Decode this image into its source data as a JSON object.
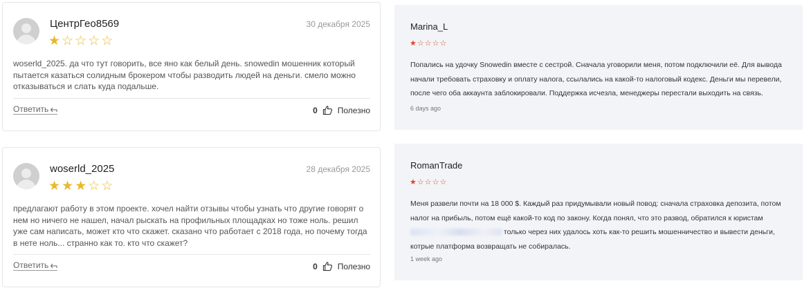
{
  "left_reviews": [
    {
      "author": "ЦентрГео8569",
      "date": "30 декабря 2025",
      "rating": 1,
      "text": "woserld_2025. да что тут говорить, все яно как белый день. snowedin мошенник который пытается казаться солидным брокером чтобы разводить людей на деньги. смело можно отказываться и слать куда подальше.",
      "reply_label": "Ответить",
      "useful_count": "0",
      "useful_label": "Полезно"
    },
    {
      "author": "woserld_2025",
      "date": "28 декабря 2025",
      "rating": 3,
      "text": "предлагают работу в этом проекте. хочел найти отзывы чтобы узнать что другие говорят о нем но ничего не нашел, начал рыскать на профильных площадках но тоже ноль. решил уже сам написать, может кто что скажет. сказано что работает с 2018 года, но почему тогда в нете ноль... странно как то. кто что скажет?",
      "reply_label": "Ответить",
      "useful_count": "0",
      "useful_label": "Полезно"
    }
  ],
  "right_reviews": [
    {
      "author": "Marina_L",
      "rating": 1,
      "text": "Попались на удочку Snowedin вместе с сестрой. Сначала уговорили меня, потом подключили её. Для вывода начали требовать страховку и оплату налога, ссылались на какой-то налоговый кодекс. Деньги мы перевели, после чего оба аккаунта заблокировали. Поддержка исчезла, менеджеры перестали выходить на связь.",
      "time": "6 days ago"
    },
    {
      "author": "RomanTrade",
      "rating": 1,
      "text_before": "Меня развели почти на 18 000 $. Каждый раз придумывали новый повод: сначала страховка депозита, потом налог на прибыль, потом ещё какой-то код по закону. Когда понял, что это развод, обратился к юристам",
      "text_after": " только через них удалось хоть как-то решить мошенничество и вывести деньги, котрые платформа возвращать не собиралась.",
      "time": "1 week ago"
    }
  ],
  "colors": {
    "star_gold": "#e8b92c",
    "star_red": "#e0452b",
    "right_card_bg": "#f3f4f7"
  }
}
